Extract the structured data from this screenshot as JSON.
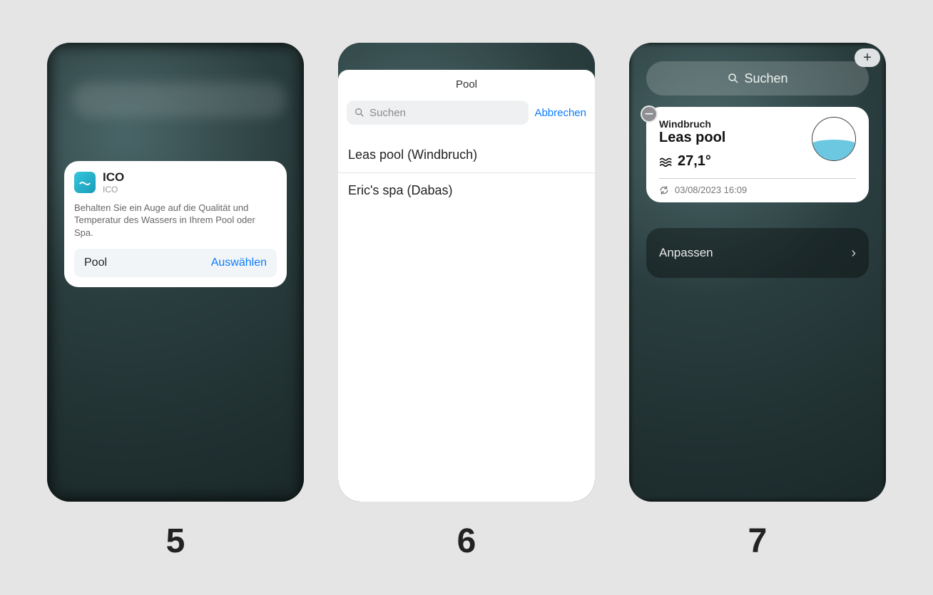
{
  "labels": {
    "s5": "5",
    "s6": "6",
    "s7": "7"
  },
  "screen5": {
    "app_name": "ICO",
    "app_sub": "ICO",
    "description": "Behalten Sie ein Auge auf die Qualität und Temperatur des Wassers in Ihrem Pool oder Spa.",
    "row_label": "Pool",
    "row_action": "Auswählen"
  },
  "screen6": {
    "title": "Pool",
    "search_placeholder": "Suchen",
    "cancel": "Abbrechen",
    "items": [
      "Leas pool (Windbruch)",
      "Eric's spa (Dabas)"
    ]
  },
  "screen7": {
    "search_label": "Suchen",
    "widget": {
      "location": "Windbruch",
      "name": "Leas pool",
      "temperature": "27,1°",
      "timestamp": "03/08/2023 16:09"
    },
    "customize": "Anpassen"
  }
}
